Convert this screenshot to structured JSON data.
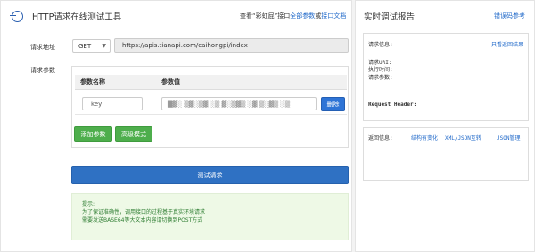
{
  "app": {
    "title": "HTTP请求在线测试工具"
  },
  "top_links": {
    "prefix": "查看“彩虹屁”接口",
    "all_params": "全部参数",
    "or": "或",
    "docs": "接口文档"
  },
  "form": {
    "url_label": "请求地址",
    "method": "GET",
    "url": "https://apis.tianapi.com/caihongpi/index",
    "params_label": "请求参数",
    "param_name_header": "参数名称",
    "param_value_header": "参数值",
    "param_key": "key",
    "param_value_masked": "█▓░ ▒▓░▒▓ ░▒ ▓░▒▓▒ ░▓ ▒░▓▒ ░▒",
    "delete_label": "删除",
    "add_param_label": "添加参数",
    "advanced_label": "高级模式",
    "test_label": "测试请求"
  },
  "tips": {
    "title": "提示:",
    "line1": "为了保证准确性，调用接口的过程基于真实环境请求",
    "line2": "需要发送BASE64等大文本内容请切换到POST方式"
  },
  "report": {
    "title": "实时调试报告",
    "error_code_link": "错误码参考",
    "request_info_label": "请求信息:",
    "only_result_link": "只看返回结果",
    "request_uri_label": "请求URI:",
    "exec_time_label": "执行时间:",
    "request_params_label": "请求参数:",
    "request_header_label": "Request Header:",
    "return_info_label": "返回信息:",
    "structure_changed_link": "结构有变化",
    "convert_link": "XML/JSON互转",
    "json_manage_link": "JSON管理"
  }
}
